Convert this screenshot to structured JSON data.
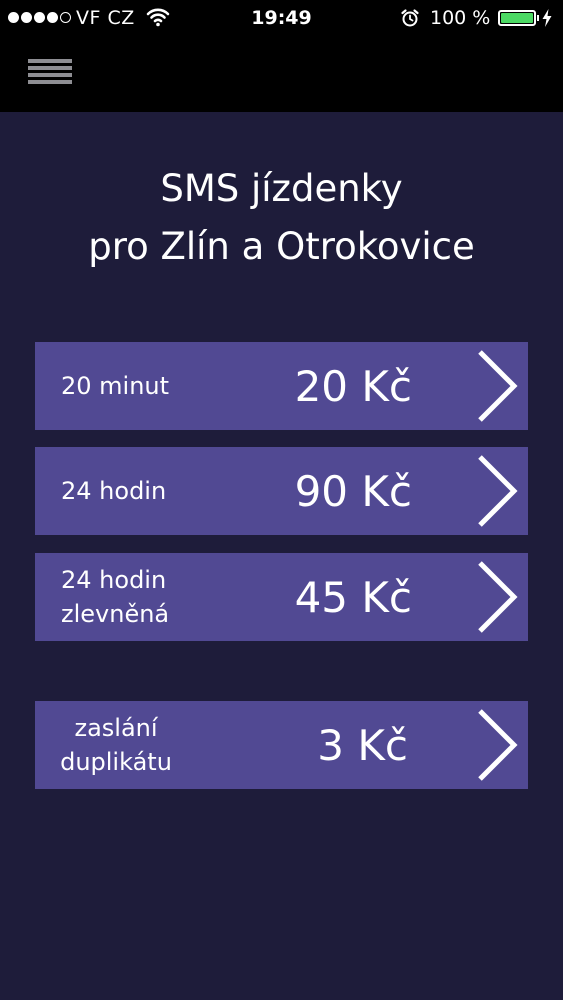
{
  "status_bar": {
    "carrier": "VF CZ",
    "time": "19:49",
    "battery_percent": "100 %",
    "battery_level": 1.0,
    "battery_color": "#4cd964",
    "signal_bars_filled": 4,
    "signal_bars_total": 5,
    "icons": [
      "wifi-icon",
      "alarm-icon",
      "battery-icon",
      "charging-bolt-icon"
    ]
  },
  "nav_bar": {
    "menu_icon": "hamburger-menu-icon"
  },
  "title": {
    "line1": "SMS jízdenky",
    "line2": "pro Zlín a Otrokovice"
  },
  "tickets": [
    {
      "label": "20 minut",
      "price": "20 Kč"
    },
    {
      "label": "24 hodin",
      "price": "90 Kč"
    },
    {
      "label": "24 hodin zlevněná",
      "price": "45 Kč"
    },
    {
      "label": "zaslání duplikátu",
      "price": "3 Kč"
    }
  ],
  "colors": {
    "background": "#1e1c3a",
    "bar_background": "#000000",
    "ticket_background": "#514993",
    "text": "#ffffff"
  }
}
